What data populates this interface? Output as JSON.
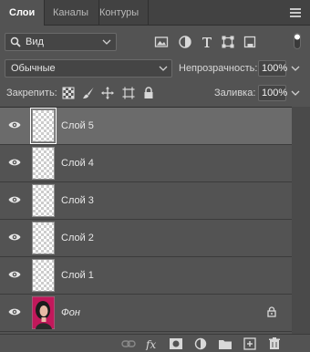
{
  "tabs": [
    {
      "label": "Слои",
      "active": true
    },
    {
      "label": "Каналы",
      "active": false
    },
    {
      "label": "Контуры",
      "active": false
    }
  ],
  "filter": {
    "kind_label": "Вид",
    "icons": [
      "image-filter-icon",
      "adjustment-filter-icon",
      "type-filter-icon",
      "shape-filter-icon",
      "smart-object-filter-icon"
    ]
  },
  "blend": {
    "mode": "Обычные",
    "opacity_label": "Непрозрачность:",
    "opacity_value": "100%"
  },
  "lock": {
    "label": "Закрепить:",
    "fill_label": "Заливка:",
    "fill_value": "100%"
  },
  "layers": [
    {
      "name": "Слой 5",
      "selected": true,
      "type": "transparent",
      "visible": true
    },
    {
      "name": "Слой 4",
      "selected": false,
      "type": "transparent",
      "visible": true
    },
    {
      "name": "Слой 3",
      "selected": false,
      "type": "transparent",
      "visible": true
    },
    {
      "name": "Слой 2",
      "selected": false,
      "type": "transparent",
      "visible": true
    },
    {
      "name": "Слой 1",
      "selected": false,
      "type": "transparent",
      "visible": true
    },
    {
      "name": "Фон",
      "selected": false,
      "type": "background",
      "visible": true,
      "locked": true
    }
  ],
  "colors": {
    "panel_bg": "#535353",
    "selected_row": "#6b6b6b",
    "thumb_accent": "#c2185b"
  }
}
